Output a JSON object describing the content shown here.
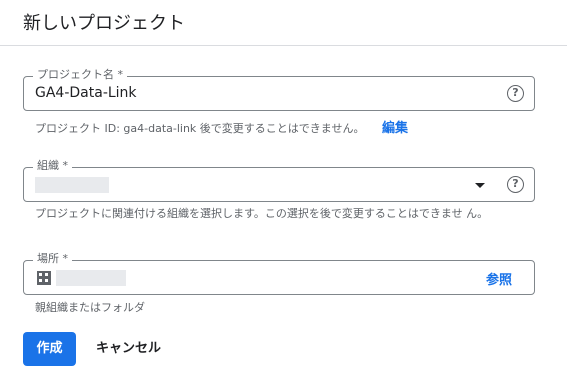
{
  "dialog": {
    "title": "新しいプロジェクト"
  },
  "project_name": {
    "label": "プロジェクト名 *",
    "value": "GA4-Data-Link",
    "help_icon": "help-icon"
  },
  "project_id": {
    "helper": "プロジェクト ID: ga4-data-link 後で変更することはできません。",
    "edit_label": "編集"
  },
  "organization": {
    "label": "組織 *",
    "value": "",
    "dropdown_icon": "dropdown-arrow-icon",
    "help_icon": "help-icon",
    "helper": "プロジェクトに関連付ける組織を選択します。この選択を後で変更することはできませ ん。"
  },
  "location": {
    "label": "場所 *",
    "value": "",
    "icon": "building-icon",
    "browse_label": "参照",
    "helper": "親組織またはフォルダ"
  },
  "actions": {
    "create_label": "作成",
    "cancel_label": "キャンセル"
  },
  "colors": {
    "accent": "#1a73e8",
    "text": "#202124",
    "muted": "#5f6368",
    "border": "#80868b"
  }
}
